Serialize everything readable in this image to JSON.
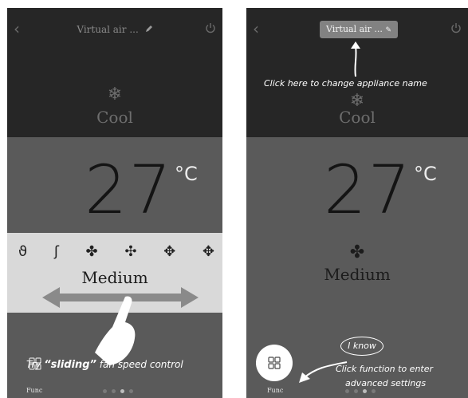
{
  "left": {
    "title": "Virtual air ...",
    "mode": "Cool",
    "temperature": "27",
    "unit": "°C",
    "fan_speed": "Medium",
    "tip_pre": "Try ",
    "tip_quoted": "“sliding”",
    "tip_post": " fan speed control",
    "func_label": "Func"
  },
  "right": {
    "name_button": "Virtual air ...",
    "name_hint": "Click here to change appliance name",
    "mode": "Cool",
    "temperature": "27",
    "unit": "°C",
    "fan_speed": "Medium",
    "i_know": "I know",
    "func_hint_line1": "Click function to enter",
    "func_hint_line2": "advanced settings",
    "func_label": "Func"
  },
  "icons": [
    "back-icon",
    "power-icon",
    "pencil-icon",
    "snowflake-icon",
    "fan-icon",
    "grid-icon",
    "hand-icon"
  ],
  "colors": {
    "top_dark": "#262626",
    "body_gray": "#5a5a5a",
    "strip": "#d9d9d9"
  }
}
